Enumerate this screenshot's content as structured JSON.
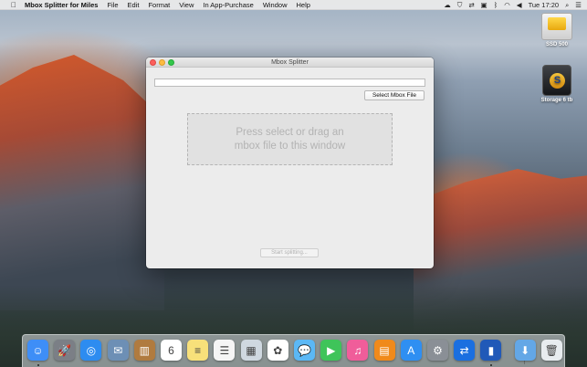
{
  "menubar": {
    "app_name": "Mbox Splitter for Miles",
    "items": [
      "File",
      "Edit",
      "Format",
      "View",
      "In App-Purchase",
      "Window",
      "Help"
    ],
    "clock": "Tue 17:20"
  },
  "desktop": {
    "disks": [
      {
        "label": "SSD 500"
      },
      {
        "label": "Storage 6 tb"
      }
    ]
  },
  "window": {
    "title": "Mbox Splitter",
    "path_value": "",
    "select_button": "Select Mbox File",
    "drop_line1": "Press select or drag an",
    "drop_line2": "mbox file to this window",
    "start_button": "Start splitting..."
  },
  "dock": {
    "apps": [
      {
        "name": "finder-icon",
        "color": "#3e8ef7",
        "glyph": "☺"
      },
      {
        "name": "launchpad-icon",
        "color": "#7b7f86",
        "glyph": "🚀"
      },
      {
        "name": "safari-icon",
        "color": "#2d8cf0",
        "glyph": "◎"
      },
      {
        "name": "mail-stamp-icon",
        "color": "#6d8fb5",
        "glyph": "✉"
      },
      {
        "name": "contacts-icon",
        "color": "#b07b3f",
        "glyph": "▥"
      },
      {
        "name": "calendar-icon",
        "color": "#ffffff",
        "glyph": "6"
      },
      {
        "name": "notes-icon",
        "color": "#f7e07a",
        "glyph": "≡"
      },
      {
        "name": "reminders-icon",
        "color": "#f5f5f5",
        "glyph": "☰"
      },
      {
        "name": "preview-icon",
        "color": "#cfd8e0",
        "glyph": "▦"
      },
      {
        "name": "photos-icon",
        "color": "#ffffff",
        "glyph": "✿"
      },
      {
        "name": "messages-icon",
        "color": "#5bb8f5",
        "glyph": "💬"
      },
      {
        "name": "facetime-icon",
        "color": "#3fc45a",
        "glyph": "▶"
      },
      {
        "name": "itunes-icon",
        "color": "#f05d9a",
        "glyph": "♫"
      },
      {
        "name": "ibooks-icon",
        "color": "#f08a1b",
        "glyph": "▤"
      },
      {
        "name": "app-store-icon",
        "color": "#2f8ff2",
        "glyph": "A"
      },
      {
        "name": "system-preferences-icon",
        "color": "#8a8f96",
        "glyph": "⚙"
      },
      {
        "name": "teamviewer-icon",
        "color": "#1a6fe0",
        "glyph": "⇄"
      },
      {
        "name": "mbox-splitter-icon",
        "color": "#2059b8",
        "glyph": "▮"
      },
      {
        "name": "downloads-folder-icon",
        "color": "#63a7e6",
        "glyph": "⬇"
      },
      {
        "name": "trash-icon",
        "color": "#e8ecef",
        "glyph": "🗑"
      }
    ]
  }
}
